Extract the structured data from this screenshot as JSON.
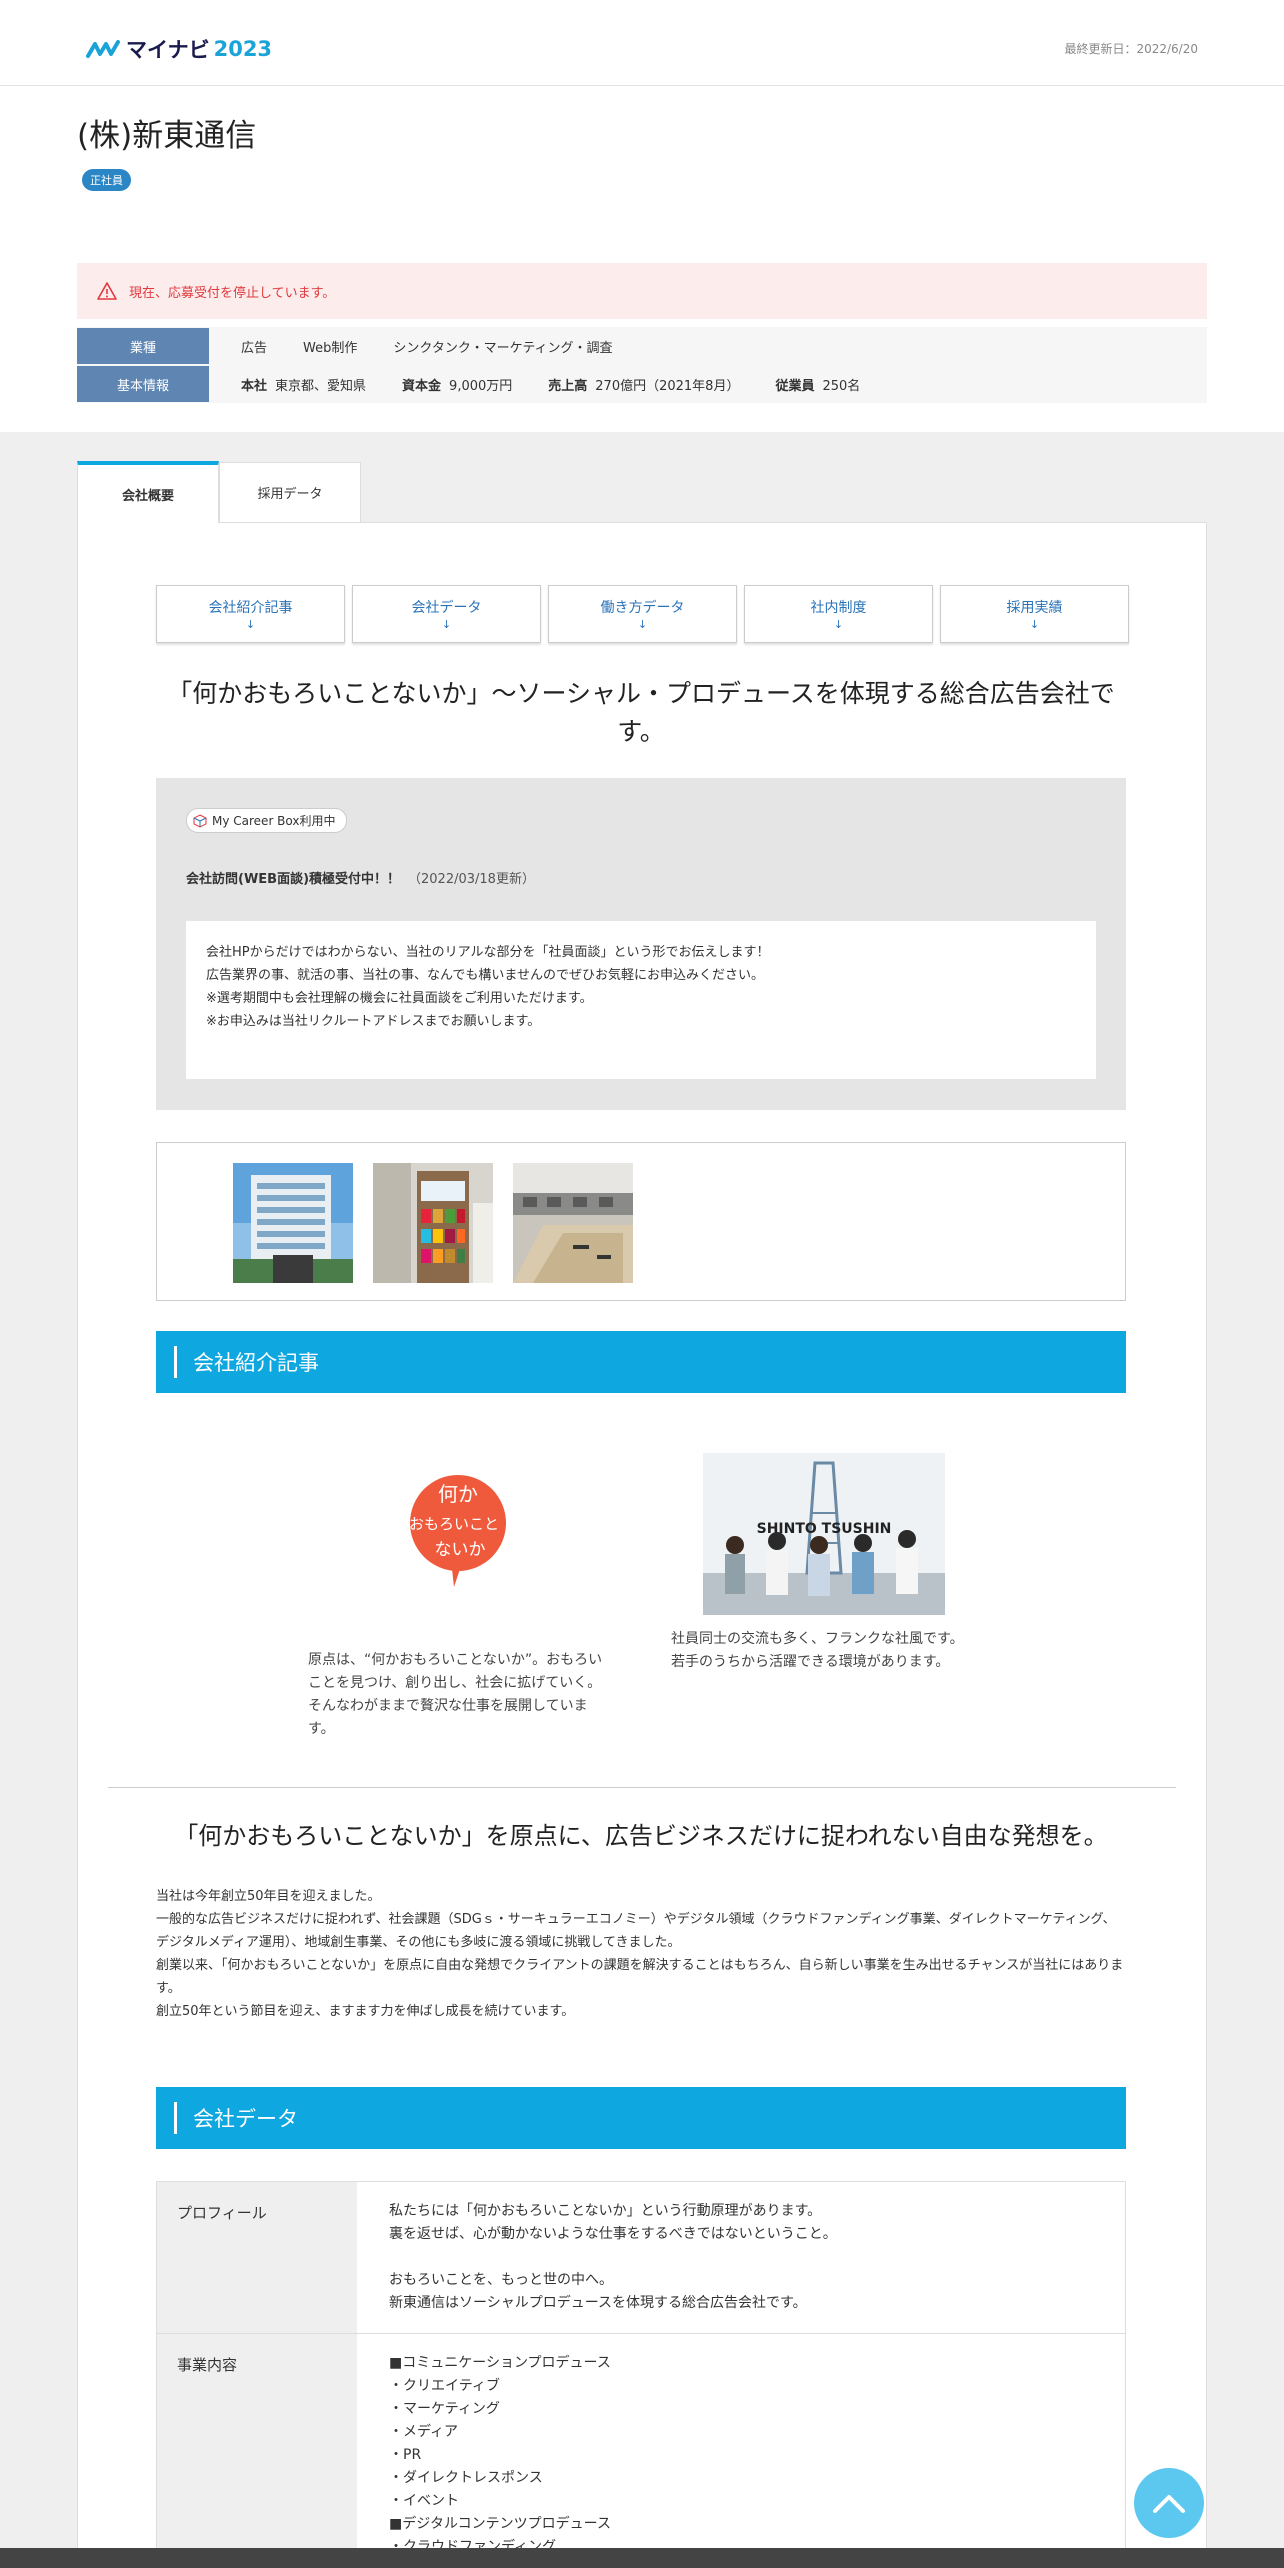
{
  "header": {
    "logo_text": "マイナビ",
    "logo_year": "2023",
    "updated": "最終更新日：2022/6/20"
  },
  "company": {
    "name": "(株)新東通信",
    "employment_badge": "正社員"
  },
  "alert": {
    "text": "現在、応募受付を停止しています。"
  },
  "info": {
    "industry_label": "業種",
    "industries": [
      "広告",
      "Web制作",
      "シンクタンク・マーケティング・調査"
    ],
    "basic_label": "基本情報",
    "hq_label": "本社",
    "hq_value": "東京都、愛知県",
    "capital_label": "資本金",
    "capital_value": "9,000万円",
    "sales_label": "売上高",
    "sales_value": "270億円（2021年8月）",
    "employees_label": "従業員",
    "employees_value": "250名"
  },
  "tabs": [
    {
      "label": "会社概要"
    },
    {
      "label": "採用データ"
    }
  ],
  "anchors": [
    {
      "label": "会社紹介記事",
      "arrow": "↓"
    },
    {
      "label": "会社データ",
      "arrow": "↓"
    },
    {
      "label": "働き方データ",
      "arrow": "↓"
    },
    {
      "label": "社内制度",
      "arrow": "↓"
    },
    {
      "label": "採用実績",
      "arrow": "↓"
    }
  ],
  "catchcopy": "「何かおもろいことないか」～ソーシャル・プロデュースを体現する総合広告会社です。",
  "careerbox": {
    "badge": "My Career Box利用中",
    "visit_title": "会社訪問(WEB面談)積極受付中！！",
    "visit_date": "（2022/03/18更新）",
    "lines": [
      "会社HPからだけではわからない、当社のリアルな部分を「社員面談」という形でお伝えします！",
      "広告業界の事、就活の事、当社の事、なんでも構いませんのでぜひお気軽にお申込みください。",
      "※選考期間中も会社理解の機会に社員面談をご利用いただけます。",
      "※お申込みは当社リクルートアドレスまでお願いします。"
    ]
  },
  "section_intro": {
    "title": "会社紹介記事",
    "article1_logo": "何か おもろいこと ないか",
    "article1_text": "原点は、“何かおもろいことないか”。おもろいことを見つけ、創り出し、社会に拡げていく。そんなわがままで贅沢な仕事を展開しています。",
    "article2_photo_text": "SHINTO TSUSHIN",
    "article2_line1": "社員同士の交流も多く、フランクな社風です。",
    "article2_line2": "若手のうちから活躍できる環境があります。"
  },
  "lead": "「何かおもろいことないか」を原点に、広告ビジネスだけに捉われない自由な発想を。",
  "body_lines": [
    "当社は今年創立50年目を迎えました。",
    "一般的な広告ビジネスだけに捉われず、社会課題（SDGｓ・サーキュラーエコノミー）やデジタル領域（クラウドファンディング事業、ダイレクトマーケティング、デジタルメディア運用）、地域創生事業、その他にも多岐に渡る領域に挑戦してきました。",
    "創業以来、「何かおもろいことないか」を原点に自由な発想でクライアントの課題を解決することはもちろん、自ら新しい事業を生み出せるチャンスが当社にはあります。",
    "創立50年という節目を迎え、ますます力を伸ばし成長を続けています。"
  ],
  "section_data": {
    "title": "会社データ",
    "rows": [
      {
        "label": "プロフィール",
        "value": "私たちには「何かおもろいことないか」という行動原理があります。\n裏を返せば、心が動かないような仕事をするべきではないということ。\n\nおもろいことを、もっと世の中へ。\n新東通信はソーシャルプロデュースを体現する総合広告会社です。"
      },
      {
        "label": "事業内容",
        "value": "■コミュニケーションプロデュース\n・クリエイティブ\n・マーケティング\n・メディア\n・PR\n・ダイレクトレスポンス\n・イベント\n■デジタルコンテンツプロデュース\n・クラウドファンディング"
      }
    ]
  },
  "colors": {
    "accent": "#0ea7e0",
    "badge": "#2b86c5",
    "info_header": "#5f86b3",
    "alert_text": "#e0393e",
    "alert_bg": "#fdecec"
  }
}
